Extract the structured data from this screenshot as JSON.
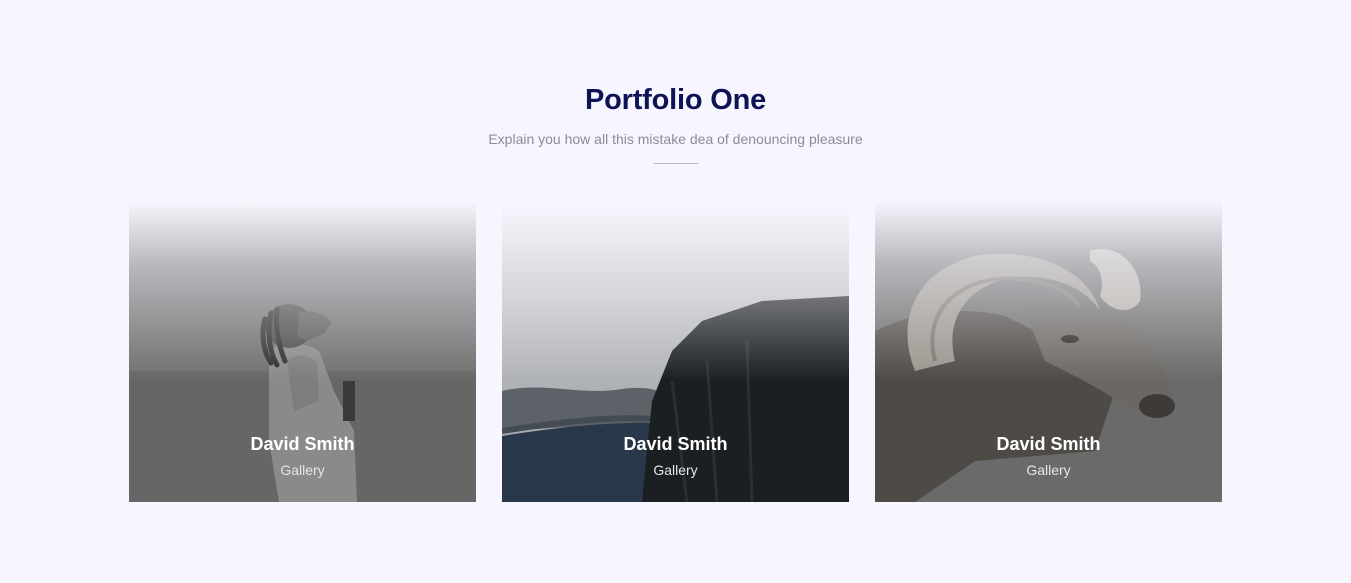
{
  "section": {
    "title": "Portfolio One",
    "subtitle": "Explain you how all this mistake dea of denouncing pleasure"
  },
  "cards": [
    {
      "name": "David Smith",
      "category": "Gallery",
      "image": "person-looking-up-photo"
    },
    {
      "name": "David Smith",
      "category": "Gallery",
      "image": "fjord-cliff-photo"
    },
    {
      "name": "David Smith",
      "category": "Gallery",
      "image": "ram-photo"
    }
  ],
  "colors": {
    "background": "#f7f6fe",
    "title": "#0e1356",
    "subtitle": "#8a8c9c"
  }
}
